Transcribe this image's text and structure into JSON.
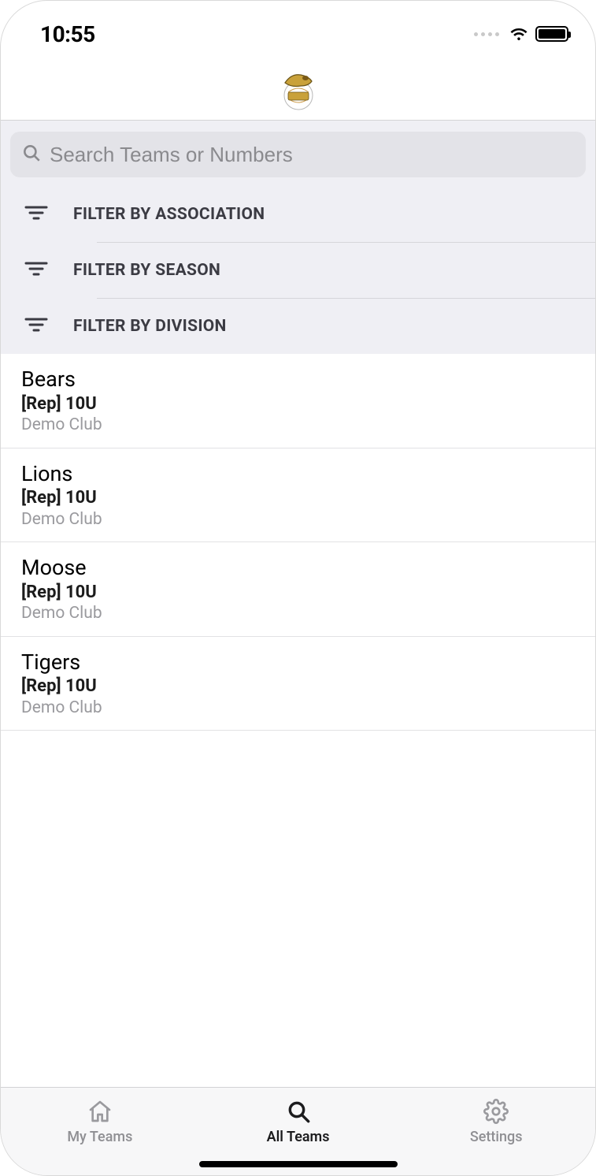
{
  "status_bar": {
    "time": "10:55"
  },
  "search": {
    "placeholder": "Search Teams or Numbers",
    "value": ""
  },
  "filters": [
    {
      "label": "FILTER BY ASSOCIATION"
    },
    {
      "label": "FILTER BY SEASON"
    },
    {
      "label": "FILTER BY DIVISION"
    }
  ],
  "teams": [
    {
      "name": "Bears",
      "division": "[Rep] 10U",
      "club": "Demo Club"
    },
    {
      "name": "Lions",
      "division": "[Rep] 10U",
      "club": "Demo Club"
    },
    {
      "name": "Moose",
      "division": "[Rep] 10U",
      "club": "Demo Club"
    },
    {
      "name": "Tigers",
      "division": "[Rep] 10U",
      "club": "Demo Club"
    }
  ],
  "tabs": {
    "my_teams": "My Teams",
    "all_teams": "All Teams",
    "settings": "Settings",
    "active": "all_teams"
  }
}
